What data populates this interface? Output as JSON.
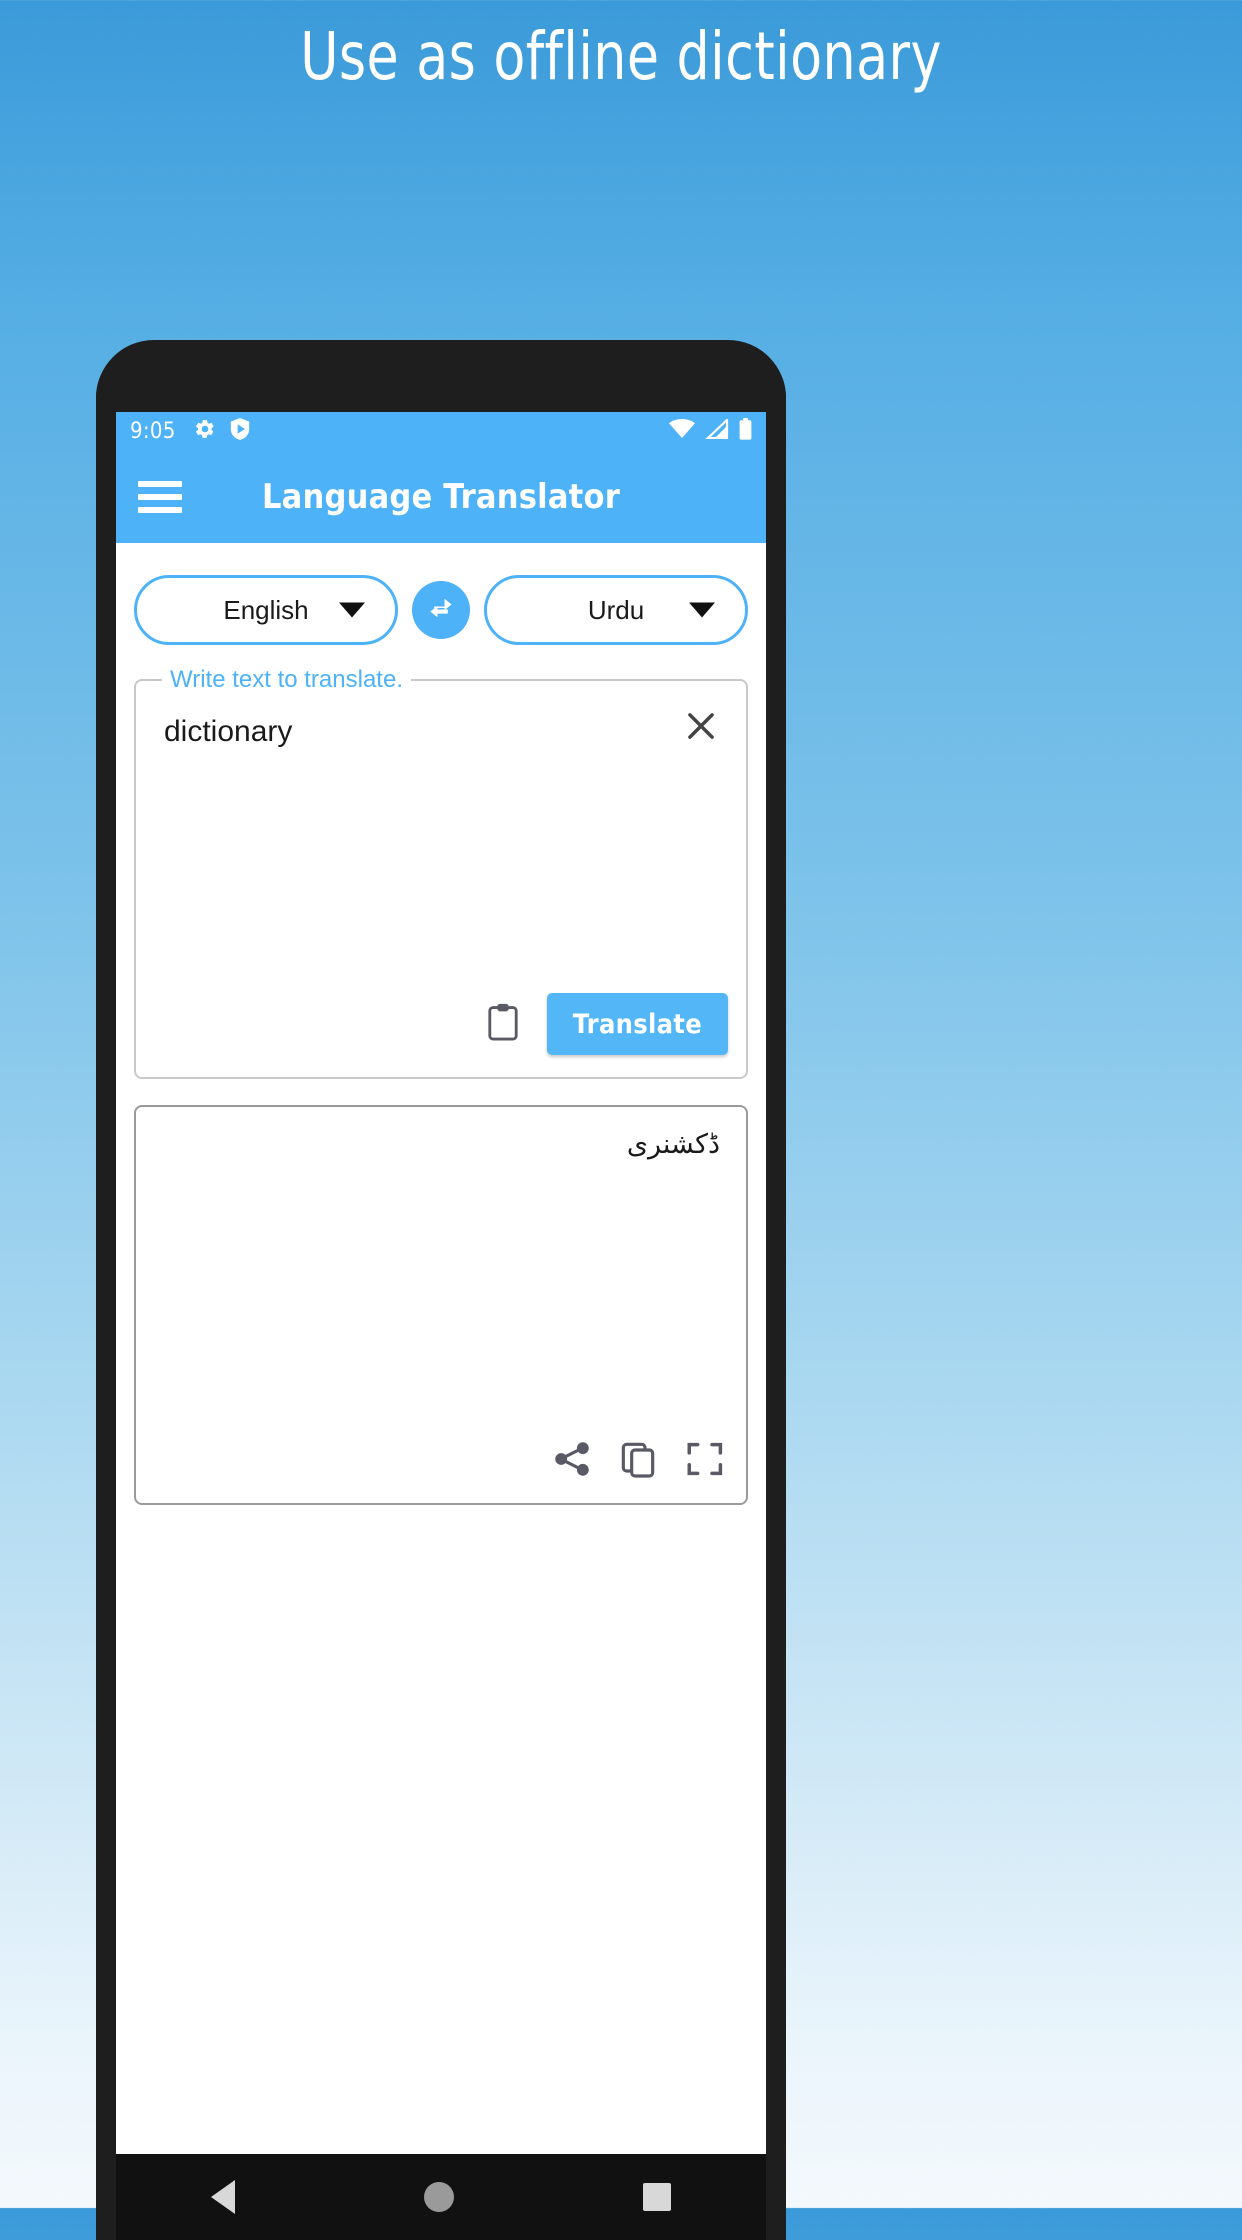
{
  "promo": {
    "headline": "Use as offline dictionary",
    "background_top_color": "#3b9ad9",
    "background_bottom_color": "#f4f9fd"
  },
  "statusbar": {
    "time": "9:05",
    "left_icons": [
      "gear-icon",
      "shield-play-icon"
    ],
    "right_icons": [
      "wifi-icon",
      "signal-icon",
      "battery-icon"
    ],
    "background_color": "#4db2f7"
  },
  "appbar": {
    "menu_icon": "hamburger-menu-icon",
    "title": "Language Translator",
    "background_color": "#4db2f7"
  },
  "language_selector": {
    "source_language": "English",
    "target_language": "Urdu",
    "swap_icon": "swap-horizontal-icon",
    "accent_color": "#4db2f7"
  },
  "input_card": {
    "label": "Write text to translate.",
    "value": "dictionary",
    "placeholder": "Write text to translate.",
    "clear_icon": "close-icon",
    "paste_icon": "clipboard-icon",
    "translate_label": "Translate",
    "translate_color": "#53b7f7"
  },
  "output_card": {
    "translated_text": "ڈکشنری",
    "share_icon": "share-icon",
    "copy_icon": "copy-icon",
    "fullscreen_icon": "fullscreen-icon"
  },
  "navbar": {
    "back_icon": "back-triangle-icon",
    "home_icon": "home-circle-icon",
    "recents_icon": "recents-square-icon"
  }
}
